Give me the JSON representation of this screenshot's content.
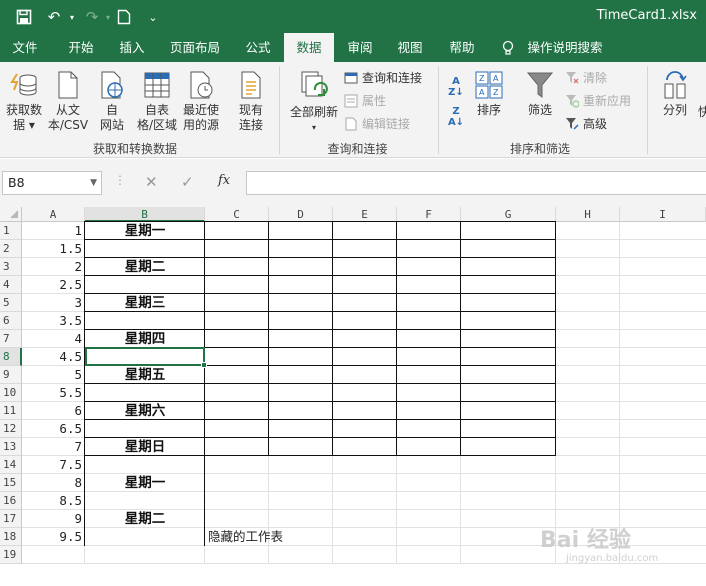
{
  "titlebar": {
    "file_name": "TimeCard1.xlsx"
  },
  "tabs": [
    "文件",
    "开始",
    "插入",
    "页面布局",
    "公式",
    "数据",
    "审阅",
    "视图",
    "帮助",
    "操作说明搜索"
  ],
  "active_tab": "数据",
  "ribbon": {
    "get_data": {
      "line1": "获取数",
      "line2": "据 ▾"
    },
    "from_csv": {
      "line1": "从文",
      "line2": "本/CSV"
    },
    "from_web": {
      "line1": "自",
      "line2": "网站"
    },
    "from_table": {
      "line1": "自表",
      "line2": "格/区域"
    },
    "recent_sources": {
      "line1": "最近使",
      "line2": "用的源"
    },
    "existing_conn": {
      "line1": "现有",
      "line2": "连接"
    },
    "group1_label": "获取和转换数据",
    "refresh_all": {
      "line1": "全部刷新",
      "line2": "▾"
    },
    "queries_connections": "查询和连接",
    "properties": "属性",
    "edit_links": "编辑链接",
    "group2_label": "查询和连接",
    "sort": "排序",
    "filter": "筛选",
    "clear": "清除",
    "reapply": "重新应用",
    "advanced": "高级",
    "group3_label": "排序和筛选",
    "text_to_columns": "分列",
    "quick": "快"
  },
  "formula_bar": {
    "name_box": "B8",
    "fx": "fx",
    "formula": ""
  },
  "columns": [
    "A",
    "B",
    "C",
    "D",
    "E",
    "F",
    "G",
    "H",
    "I"
  ],
  "selected_column": "B",
  "selected_row": 8,
  "rows": [
    {
      "n": "1",
      "a": "1",
      "b": "星期一"
    },
    {
      "n": "2",
      "a": "1.5",
      "b": ""
    },
    {
      "n": "3",
      "a": "2",
      "b": "星期二"
    },
    {
      "n": "4",
      "a": "2.5",
      "b": ""
    },
    {
      "n": "5",
      "a": "3",
      "b": "星期三"
    },
    {
      "n": "6",
      "a": "3.5",
      "b": ""
    },
    {
      "n": "7",
      "a": "4",
      "b": "星期四"
    },
    {
      "n": "8",
      "a": "4.5",
      "b": ""
    },
    {
      "n": "9",
      "a": "5",
      "b": "星期五"
    },
    {
      "n": "10",
      "a": "5.5",
      "b": ""
    },
    {
      "n": "11",
      "a": "6",
      "b": "星期六"
    },
    {
      "n": "12",
      "a": "6.5",
      "b": ""
    },
    {
      "n": "13",
      "a": "7",
      "b": "星期日"
    },
    {
      "n": "14",
      "a": "7.5",
      "b": ""
    },
    {
      "n": "15",
      "a": "8",
      "b": "星期一"
    },
    {
      "n": "16",
      "a": "8.5",
      "b": ""
    },
    {
      "n": "17",
      "a": "9",
      "b": "星期二"
    },
    {
      "n": "18",
      "a": "9.5",
      "b": ""
    },
    {
      "n": "19",
      "a": "",
      "b": ""
    }
  ],
  "hidden_sheet_note": "隐藏的工作表",
  "watermark": {
    "main": "Bai 经验",
    "sub": "jingyan.baidu.com"
  },
  "colors": {
    "excel_green": "#217346",
    "ribbon_bg": "#f3f3f3"
  }
}
